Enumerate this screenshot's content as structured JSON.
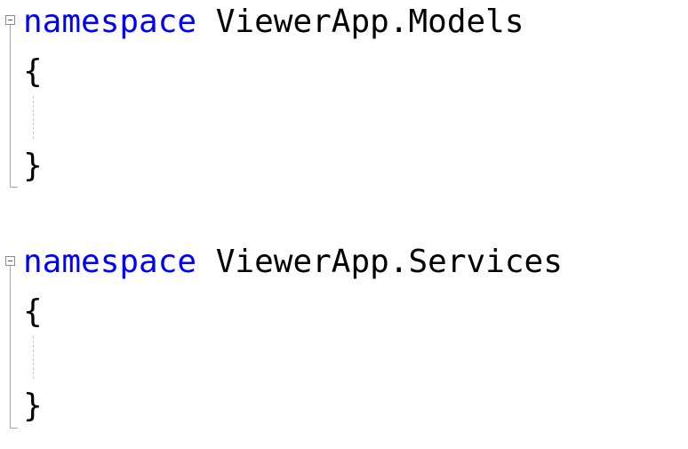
{
  "blocks": [
    {
      "keyword": "namespace",
      "name": " ViewerApp.Models",
      "open_brace": "{",
      "close_brace": "}"
    },
    {
      "keyword": "namespace",
      "name": " ViewerApp.Services",
      "open_brace": "{",
      "close_brace": "}"
    }
  ],
  "colors": {
    "keyword": "#0000ff",
    "text": "#000000",
    "background": "#ffffff"
  }
}
